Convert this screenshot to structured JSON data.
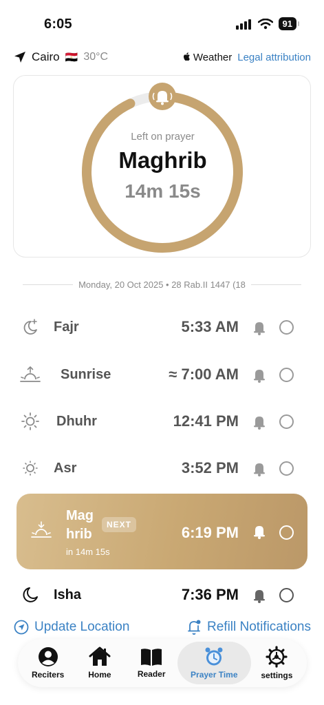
{
  "status_bar": {
    "time": "6:05",
    "battery": "91"
  },
  "location": {
    "city": "Cairo",
    "flag": "🇪🇬",
    "temperature": "30°C",
    "weather_label": "Weather",
    "legal_label": "Legal attribution"
  },
  "countdown": {
    "subtitle": "Left on prayer",
    "prayer": "Maghrib",
    "remaining": "14m 15s",
    "progress": 0.93
  },
  "date": {
    "text": "Monday, 20 Oct 2025  •  28 Rab.II 1447 (18"
  },
  "prayers": [
    {
      "name": "Fajr",
      "time": "5:33 AM",
      "icon": "moon-star-icon"
    },
    {
      "name": "Sunrise",
      "time": "≈ 7:00 AM",
      "icon": "sunrise-icon"
    },
    {
      "name": "Dhuhr",
      "time": "12:41 PM",
      "icon": "sun-icon"
    },
    {
      "name": "Asr",
      "time": "3:52 PM",
      "icon": "sun-small-icon"
    }
  ],
  "next_prayer": {
    "name": "Maghrib",
    "name_line1": "Mag",
    "name_line2": "hrib",
    "badge": "NEXT",
    "subtitle": "in 14m 15s",
    "time": "6:19 PM",
    "icon": "sunset-icon"
  },
  "isha": {
    "name": "Isha",
    "time": "7:36 PM",
    "icon": "moon-icon"
  },
  "actions": {
    "update_location": "Update Location",
    "refill_notifications": "Refill Notifications"
  },
  "tabs": [
    {
      "label": "Reciters",
      "icon": "person-icon"
    },
    {
      "label": "Home",
      "icon": "home-icon"
    },
    {
      "label": "Reader",
      "icon": "book-icon"
    },
    {
      "label": "Prayer Time",
      "icon": "alarm-clock-icon",
      "active": true
    },
    {
      "label": "settings",
      "icon": "gear-icon"
    }
  ],
  "colors": {
    "accent": "#c6a470",
    "link": "#3b82c4",
    "muted": "#8a8a8a"
  }
}
